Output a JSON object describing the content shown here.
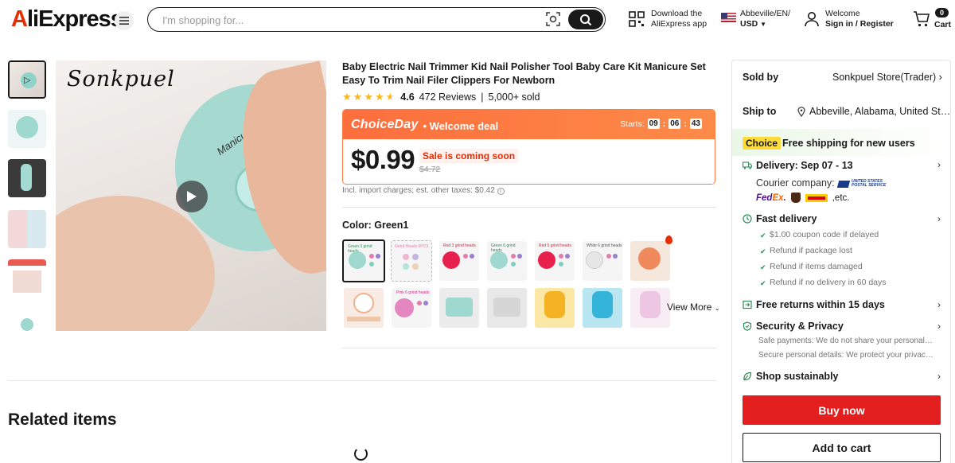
{
  "header": {
    "logo": "AliExpress",
    "search_placeholder": "I'm shopping for...",
    "download_line1": "Download the",
    "download_line2": "AliExpress app",
    "locale_line1": "Abbeville/EN/",
    "locale_line2": "USD",
    "welcome_line1": "Welcome",
    "welcome_line2": "Sign in / Register",
    "cart_label": "Cart",
    "cart_count": "0"
  },
  "gallery": {
    "brand_watermark": "Sonkpuel"
  },
  "product": {
    "title": "Baby Electric Nail Trimmer Kid Nail Polisher Tool Baby Care Kit Manicure Set Easy To Trim Nail Filer Clippers For Newborn",
    "rating": "4.6",
    "reviews": "472 Reviews",
    "sold": "5,000+ sold",
    "deal_brand": "ChoiceDay",
    "deal_label": "Welcome deal",
    "starts_label": "Starts:",
    "timer": [
      "09",
      "06",
      "43"
    ],
    "price": "$0.99",
    "sale_badge": "Sale is coming soon",
    "original_price": "$4.72",
    "taxes": "Incl. import charges; est. other taxes: $0.42",
    "color_label": "Color: Green1",
    "view_more": "View More",
    "swatches_row1": [
      "Green 3 grind heads",
      "Grind Heads 6PCS",
      "Red 3 grind heads",
      "Green 6 grind heads",
      "Red 6 grind heads",
      "White 6 grind heads",
      ""
    ],
    "swatches_row2": [
      "",
      "Pink 6 grind heads",
      "",
      "",
      "",
      "",
      ""
    ]
  },
  "related_title": "Related items",
  "panel": {
    "sold_by_label": "Sold by",
    "store_name": "Sonkpuel Store(Trader)",
    "ship_to_label": "Ship to",
    "ship_location": "Abbeville, Alabama, United States",
    "choice_tag": "Choice",
    "free_shipping": "Free shipping for new users",
    "delivery": "Delivery: Sep 07 - 13",
    "courier_label": "Courier company:",
    "usps_text": "UNITED STATES POSTAL SERVICE",
    "carriers_etc": ",etc.",
    "fast_delivery": "Fast delivery",
    "fast_items": [
      "$1.00 coupon code if delayed",
      "Refund if package lost",
      "Refund if items damaged",
      "Refund if no delivery in 60 days"
    ],
    "free_returns": "Free returns within 15 days",
    "security": "Security & Privacy",
    "security_items": [
      "Safe payments: We do not share your personal details with any third-party sellers",
      "Secure personal details: We protect your privacy and keep your personal details safe"
    ],
    "sustainably": "Shop sustainably",
    "buy_now": "Buy now",
    "add_to_cart": "Add to cart"
  },
  "colors": {
    "brand_red": "#e62e04",
    "deal_orange": "#fd7b44",
    "buy_red": "#e31e1e",
    "choice_yellow": "#fddb3a",
    "star": "#fdb714"
  }
}
